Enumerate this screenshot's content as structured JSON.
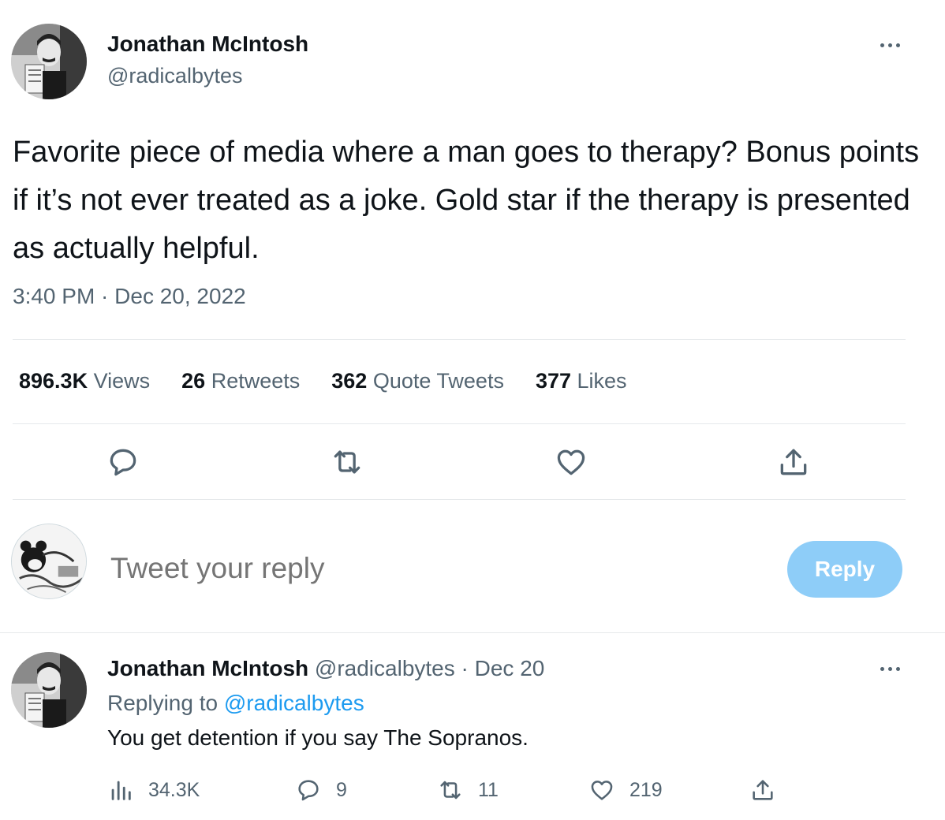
{
  "tweet": {
    "author_name": "Jonathan McIntosh",
    "author_handle": "@radicalbytes",
    "text": "Favorite piece of media where a man goes to therapy? Bonus points if it’s not ever treated as a joke. Gold star if the therapy is presented as actually helpful.",
    "timestamp": "3:40 PM · Dec 20, 2022",
    "stats": {
      "views_count": "896.3K",
      "views_label": "Views",
      "retweets_count": "26",
      "retweets_label": "Retweets",
      "quotes_count": "362",
      "quotes_label": "Quote Tweets",
      "likes_count": "377",
      "likes_label": "Likes"
    },
    "actions": [
      "reply-icon",
      "retweet-icon",
      "like-icon",
      "share-icon"
    ]
  },
  "compose": {
    "placeholder": "Tweet your reply",
    "button_label": "Reply",
    "button_color": "#8ecdf8"
  },
  "reply": {
    "author_name": "Jonathan McIntosh",
    "meta": "@radicalbytes · Dec 20",
    "replying_prefix": "Replying to",
    "replying_handle": "@radicalbytes",
    "text": "You get detention if you say The Sopranos.",
    "views": "34.3K",
    "replies": "9",
    "retweets": "11",
    "likes": "219"
  },
  "colors": {
    "text_primary": "#0f1419",
    "text_secondary": "#536471",
    "link": "#1d9bf0",
    "icon_accent": "#1d9bf0"
  }
}
